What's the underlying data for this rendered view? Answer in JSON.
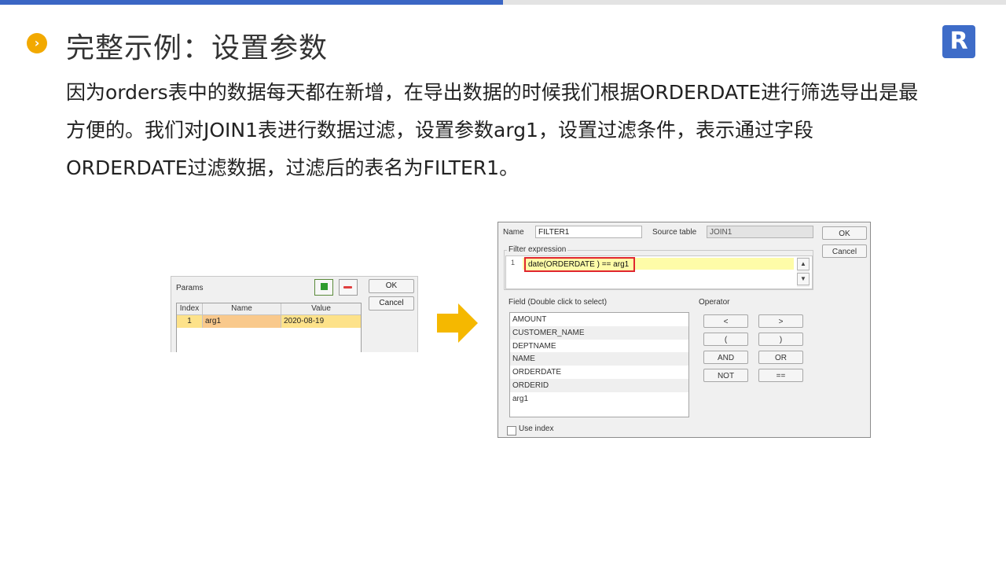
{
  "header": {
    "title": "完整示例：设置参数",
    "bullet_icon": "chevron-right-icon",
    "logo": "R"
  },
  "body_text": [
    "因为orders表中的数据每天都在新增，在导出数据的时候我们根据ORDERDATE进行筛选导出是最",
    "方便的。我们对JOIN1表进行数据过滤，设置参数arg1，设置过滤条件，表示通过字段",
    "ORDERDATE过滤数据，过滤后的表名为FILTER1。"
  ],
  "params_dialog": {
    "label": "Params",
    "add_icon": "plus-icon",
    "remove_icon": "minus-icon",
    "columns": [
      "Index",
      "Name",
      "Value"
    ],
    "rows": [
      {
        "index": "1",
        "name": "arg1",
        "value": "2020-08-19"
      }
    ],
    "ok_label": "OK",
    "cancel_label": "Cancel"
  },
  "arrow_icon": "arrow-right-icon",
  "filter_dialog": {
    "name_label": "Name",
    "name_value": "FILTER1",
    "source_label": "Source table",
    "source_value": "JOIN1",
    "ok_label": "OK",
    "cancel_label": "Cancel",
    "filter_group_label": "Filter expression",
    "line_number": "1",
    "expression": "date(ORDERDATE ) == arg1",
    "field_label": "Field (Double click to select)",
    "fields": [
      "AMOUNT",
      "CUSTOMER_NAME",
      "DEPTNAME",
      "NAME",
      "ORDERDATE",
      "ORDERID",
      "arg1"
    ],
    "operator_label": "Operator",
    "operators": [
      "<",
      ">",
      "(",
      ")",
      "AND",
      "OR",
      "NOT",
      "=="
    ],
    "use_index_label": "Use index",
    "scroll_up_icon": "chevron-up-icon",
    "scroll_down_icon": "chevron-down-icon"
  },
  "colors": {
    "accent_blue": "#3b66c4",
    "bullet_orange": "#f2a900",
    "arrow_yellow": "#f5b800",
    "highlight_red": "#e0262e"
  }
}
